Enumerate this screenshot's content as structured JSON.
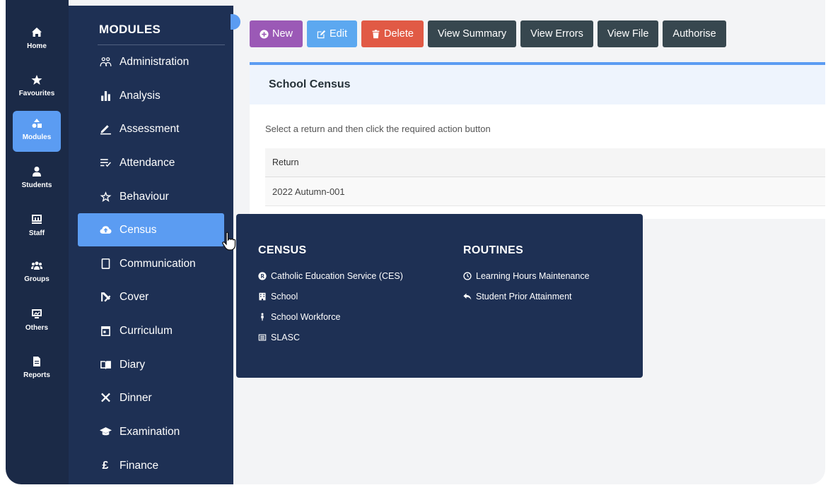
{
  "rail": [
    {
      "label": "Home",
      "icon": "home-icon"
    },
    {
      "label": "Favourites",
      "icon": "star-icon"
    },
    {
      "label": "Modules",
      "icon": "modules-icon",
      "active": true
    },
    {
      "label": "Students",
      "icon": "student-icon"
    },
    {
      "label": "Staff",
      "icon": "staff-icon"
    },
    {
      "label": "Groups",
      "icon": "groups-icon"
    },
    {
      "label": "Others",
      "icon": "others-icon"
    },
    {
      "label": "Reports",
      "icon": "report-icon"
    }
  ],
  "modules": {
    "title": "MODULES",
    "items": [
      {
        "label": "Administration",
        "icon": "users-icon"
      },
      {
        "label": "Analysis",
        "icon": "bar-chart-icon"
      },
      {
        "label": "Assessment",
        "icon": "pen-icon"
      },
      {
        "label": "Attendance",
        "icon": "list-check-icon"
      },
      {
        "label": "Behaviour",
        "icon": "star-outline-icon"
      },
      {
        "label": "Census",
        "icon": "cloud-upload-icon",
        "active": true
      },
      {
        "label": "Communication",
        "icon": "phone-icon"
      },
      {
        "label": "Cover",
        "icon": "cover-icon"
      },
      {
        "label": "Curriculum",
        "icon": "calendar-icon"
      },
      {
        "label": "Diary",
        "icon": "book-icon"
      },
      {
        "label": "Dinner",
        "icon": "cutlery-icon"
      },
      {
        "label": "Examination",
        "icon": "graduation-cap-icon"
      },
      {
        "label": "Finance",
        "icon": "pound-icon"
      }
    ]
  },
  "toolbar": {
    "new_label": "New",
    "edit_label": "Edit",
    "delete_label": "Delete",
    "view_summary_label": "View Summary",
    "view_errors_label": "View Errors",
    "view_file_label": "View File",
    "authorise_label": "Authorise"
  },
  "card": {
    "title": "School Census",
    "hint": "Select a return and then click the required action button",
    "column_header": "Return",
    "rows": [
      "2022 Autumn-001"
    ]
  },
  "flyout": {
    "census_heading": "CENSUS",
    "census_links": [
      {
        "label": "Catholic Education Service (CES)",
        "icon": "registered-icon"
      },
      {
        "label": "School",
        "icon": "building-icon"
      },
      {
        "label": "School Workforce",
        "icon": "person-icon"
      },
      {
        "label": "SLASC",
        "icon": "document-icon"
      }
    ],
    "routines_heading": "ROUTINES",
    "routines_links": [
      {
        "label": "Learning Hours Maintenance",
        "icon": "clock-icon"
      },
      {
        "label": "Student Prior Attainment",
        "icon": "reply-icon"
      }
    ]
  },
  "colors": {
    "rail_bg": "#1b2a47",
    "panel_bg": "#1e3054",
    "accent": "#5b9cf2",
    "new_button": "#9b59b6",
    "edit_button": "#5ca8f0",
    "delete_button": "#e15a45",
    "dark_button": "#37474f"
  }
}
